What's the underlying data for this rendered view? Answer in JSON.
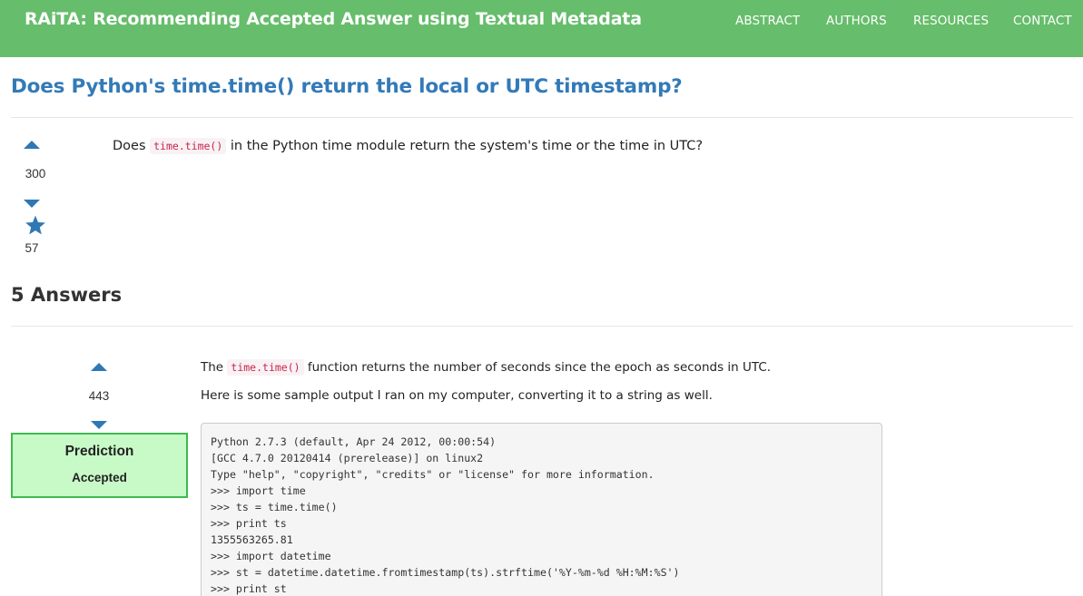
{
  "header": {
    "brand": "RAiTA: Recommending Accepted Answer using Textual Metadata",
    "nav": [
      "ABSTRACT",
      "AUTHORS",
      "RESOURCES",
      "CONTACT"
    ]
  },
  "question": {
    "title": "Does Python's time.time() return the local or UTC timestamp?",
    "votes": "300",
    "favorites": "57",
    "body_pre": "Does ",
    "body_code": "time.time()",
    "body_post": " in the Python time module return the system's time or the time in UTC?"
  },
  "answers_heading": "5 Answers",
  "answer": {
    "votes": "443",
    "p1_pre": "The ",
    "p1_code": "time.time()",
    "p1_post": " function returns the number of seconds since the epoch as seconds in UTC.",
    "p2": "Here is some sample output I ran on my computer, converting it to a string as well.",
    "prediction_title": "Prediction",
    "prediction_label": "Accepted",
    "code_lines": [
      "Python 2.7.3 (default, Apr 24 2012, 00:00:54)",
      "[GCC 4.7.0 20120414 (prerelease)] on linux2",
      "Type \"help\", \"copyright\", \"credits\" or \"license\" for more information.",
      ">>> import time",
      ">>> ts = time.time()",
      ">>> print ts",
      "1355563265.81",
      ">>> import datetime",
      ">>> st = datetime.datetime.fromtimestamp(ts).strftime('%Y-%m-%d %H:%M:%S')",
      ">>> print st"
    ]
  },
  "colors": {
    "navbar": "#66bd6b",
    "link": "#337ab7",
    "vote_icon": "#2f78b4",
    "prediction_bg": "#c8fac8",
    "prediction_border": "#3fb94f"
  },
  "icons": {
    "upvote": "caret-up-icon",
    "downvote": "caret-down-icon",
    "favorite": "star-icon"
  }
}
